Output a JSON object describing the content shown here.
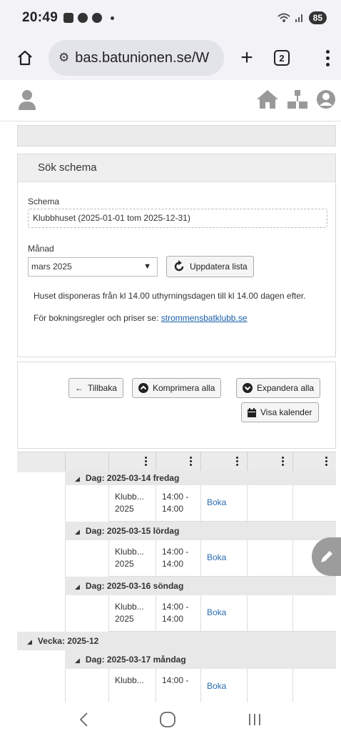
{
  "status": {
    "time": "20:49",
    "battery": "85"
  },
  "browser": {
    "url": "bas.batunionen.se/W",
    "tab_count": "2"
  },
  "search_panel": {
    "title": "Sök schema",
    "schema_label": "Schema",
    "schema_value": "Klubbhuset (2025-01-01 tom 2025-12-31)",
    "month_label": "Månad",
    "month_value": "mars 2025",
    "refresh_label": "Uppdatera lista",
    "info_text": "Huset disponeras från kl 14.00 uthyrningsdagen till kl 14.00 dagen efter.",
    "rules_text": "För bokningsregler och priser se:",
    "rules_link": "strommensbatklubb.se"
  },
  "actions": {
    "back": "Tillbaka",
    "collapse_all": "Komprimera alla",
    "expand_all": "Expandera alla",
    "show_calendar": "Visa kalender"
  },
  "schedule": {
    "day_0": "Dag: 2025-03-14 fredag",
    "day_1": "Dag: 2025-03-15 lördag",
    "day_2": "Dag: 2025-03-16 söndag",
    "week_1": "Vecka: 2025-12",
    "day_3": "Dag: 2025-03-17 måndag",
    "rows": [
      {
        "object": "Klubb... 2025",
        "time": "14:00 - 14:00",
        "action": "Boka"
      },
      {
        "object": "Klubb... 2025",
        "time": "14:00 - 14:00",
        "action": "Boka"
      },
      {
        "object": "Klubb... 2025",
        "time": "14:00 - 14:00",
        "action": "Boka"
      },
      {
        "object": "Klubb...",
        "time": "14:00 -",
        "action": "Boka"
      }
    ]
  },
  "colors": {
    "link": "#1a5fa8",
    "boka": "#2a6db0",
    "header_gray": "#ebebeb"
  }
}
